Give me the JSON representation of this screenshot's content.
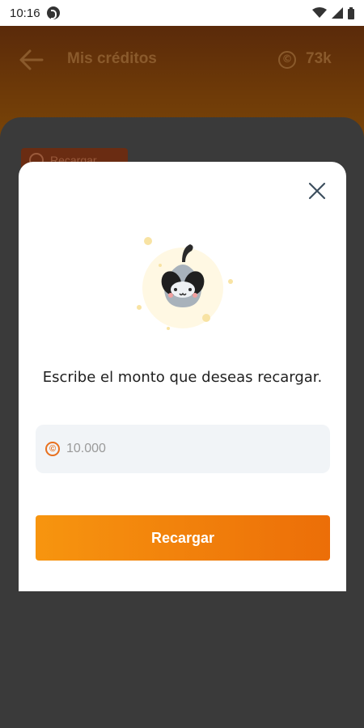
{
  "status_bar": {
    "time": "10:16"
  },
  "header": {
    "title": "Mis créditos",
    "credits": "73k",
    "coin_symbol": "©"
  },
  "background": {
    "chip_label": "Recargar"
  },
  "modal": {
    "prompt": "Escribe el monto que deseas recargar.",
    "amount_placeholder": "10.000",
    "coin_symbol": "©",
    "submit_label": "Recargar"
  },
  "colors": {
    "accent_start": "#f7950f",
    "accent_end": "#ec6e08",
    "field_bg": "#f1f4f7"
  },
  "icons": [
    "back-arrow-icon",
    "coin-icon",
    "close-icon",
    "wifi-icon",
    "signal-icon",
    "battery-icon"
  ]
}
